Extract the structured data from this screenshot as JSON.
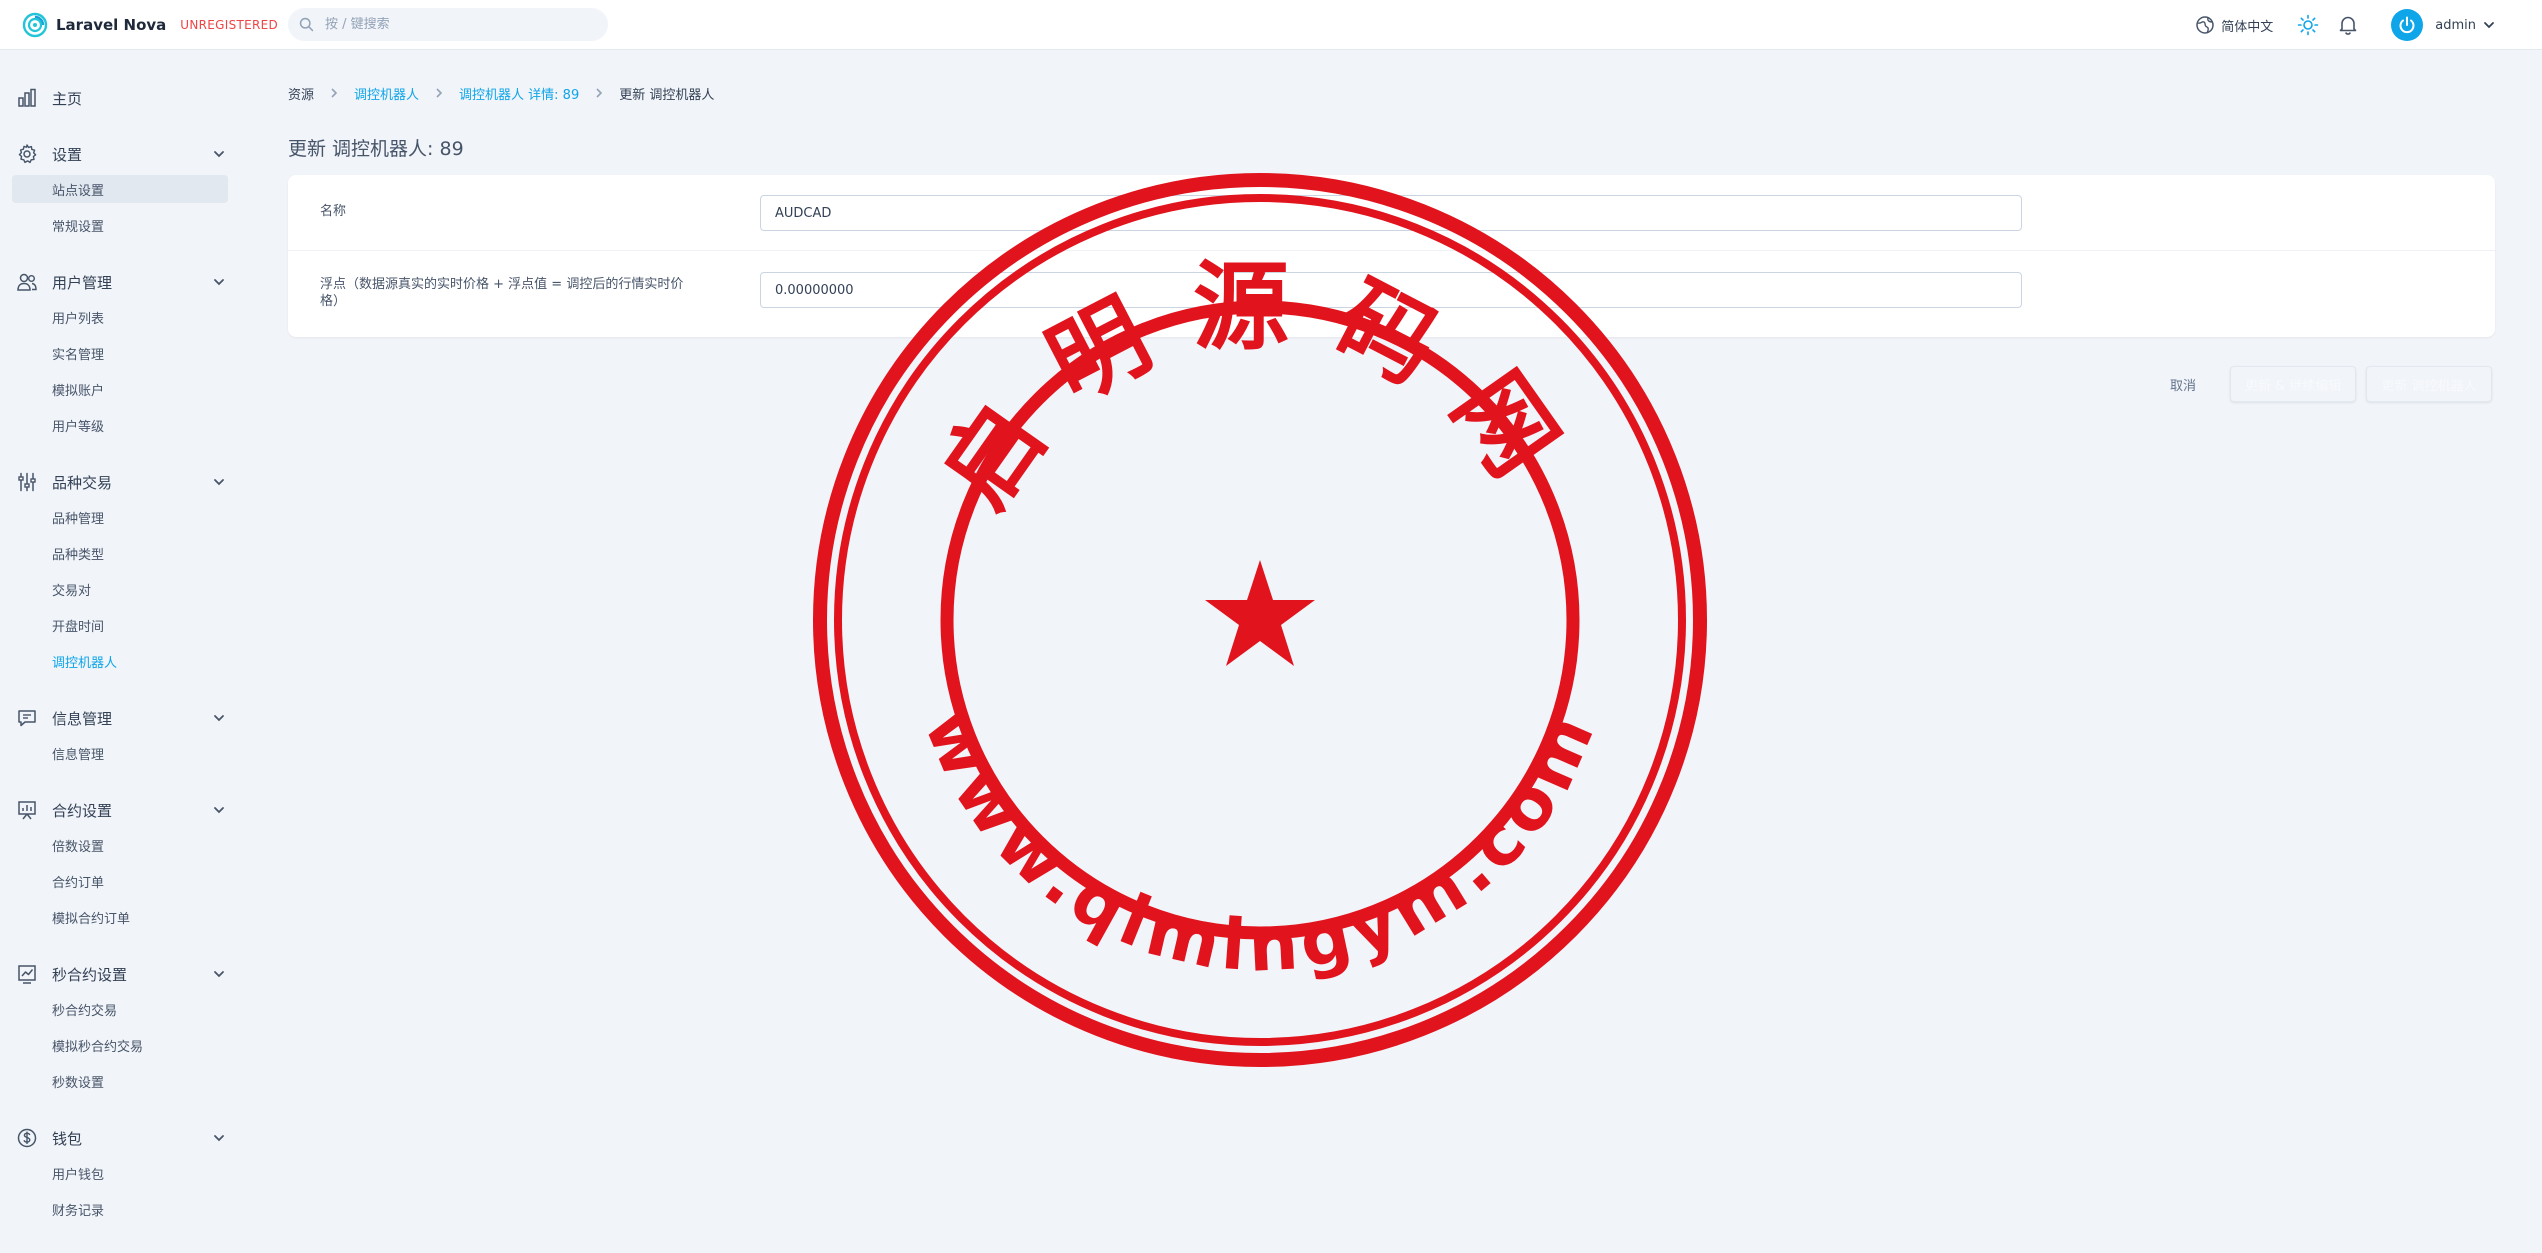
{
  "header": {
    "brand_name": "Laravel Nova",
    "brand_tag": "UNREGISTERED",
    "search_placeholder": "按 / 键搜索",
    "language": "简体中文",
    "user_name": "admin"
  },
  "sidebar": {
    "groups": [
      {
        "label": "主页",
        "icon": "chart-bar-icon",
        "items": []
      },
      {
        "label": "设置",
        "icon": "gear-icon",
        "items": [
          "站点设置",
          "常规设置"
        ]
      },
      {
        "label": "用户管理",
        "icon": "users-icon",
        "items": [
          "用户列表",
          "实名管理",
          "模拟账户",
          "用户等级"
        ]
      },
      {
        "label": "品种交易",
        "icon": "sliders-icon",
        "items": [
          "品种管理",
          "品种类型",
          "交易对",
          "开盘时间",
          "调控机器人"
        ]
      },
      {
        "label": "信息管理",
        "icon": "chat-icon",
        "items": [
          "信息管理"
        ]
      },
      {
        "label": "合约设置",
        "icon": "presentation-chart-icon",
        "items": [
          "倍数设置",
          "合约订单",
          "模拟合约订单"
        ]
      },
      {
        "label": "秒合约设置",
        "icon": "trend-chart-icon",
        "items": [
          "秒合约交易",
          "模拟秒合约交易",
          "秒数设置"
        ]
      },
      {
        "label": "钱包",
        "icon": "dollar-icon",
        "items": [
          "用户钱包",
          "财务记录"
        ]
      }
    ],
    "active_item": "站点设置",
    "current_item": "调控机器人"
  },
  "breadcrumb": {
    "items": [
      "资源",
      "调控机器人",
      "调控机器人 详情: 89",
      "更新 调控机器人"
    ]
  },
  "page": {
    "title": "更新 调控机器人: 89"
  },
  "form": {
    "fields": [
      {
        "label": "名称",
        "value": "AUDCAD"
      },
      {
        "label": "浮点（数据源真实的实时价格 + 浮点值 = 调控后的行情实时价格）",
        "value": "0.00000000"
      }
    ]
  },
  "actions": {
    "cancel": "取消",
    "update_continue": "更新 & 继续编辑",
    "update": "更新 调控机器人"
  },
  "watermark": {
    "top_text": "启明源码网",
    "bottom_text": "www.qimingym.com",
    "color": "#e1141e"
  },
  "colors": {
    "accent": "#0ea5e9",
    "tag_red": "#ef4444",
    "background": "#f1f4f9"
  }
}
